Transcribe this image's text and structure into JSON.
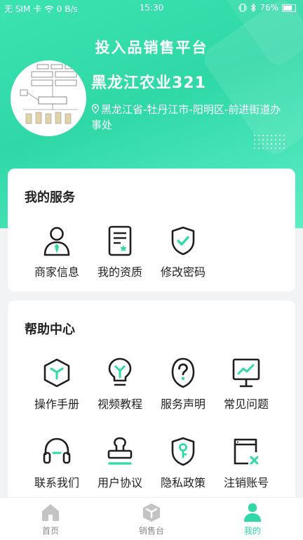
{
  "status_bar": {
    "carrier": "无 SIM 卡",
    "speed": "0 B/s",
    "time": "15:30",
    "battery": "76%"
  },
  "header": {
    "title": "投入品销售平台",
    "company_name": "黑龙江农业321",
    "address": "黑龙江省-牡丹江市-阳明区-前进街道办事处",
    "avatar_image": "network-diagram"
  },
  "my_services": {
    "title": "我的服务",
    "items": [
      {
        "label": "商家信息",
        "icon": "merchant-person-icon"
      },
      {
        "label": "我的资质",
        "icon": "certificate-doc-icon"
      },
      {
        "label": "修改密码",
        "icon": "shield-check-icon"
      }
    ]
  },
  "help_center": {
    "title": "帮助中心",
    "items": [
      {
        "label": "操作手册",
        "icon": "cube-icon"
      },
      {
        "label": "视频教程",
        "icon": "lightbulb-icon"
      },
      {
        "label": "服务声明",
        "icon": "question-shield-icon"
      },
      {
        "label": "常见问题",
        "icon": "chart-board-icon"
      },
      {
        "label": "联系我们",
        "icon": "headset-icon"
      },
      {
        "label": "用户协议",
        "icon": "stamp-icon"
      },
      {
        "label": "隐私政策",
        "icon": "shield-key-icon"
      },
      {
        "label": "注销账号",
        "icon": "window-close-icon"
      }
    ]
  },
  "tab_bar": {
    "tabs": [
      {
        "label": "首页",
        "icon": "home-icon"
      },
      {
        "label": "销售台",
        "icon": "box-icon"
      },
      {
        "label": "我的",
        "icon": "user-icon",
        "active": true
      }
    ]
  },
  "colors": {
    "accent": "#2fd8a6",
    "icon_dark": "#1f1f1f"
  }
}
